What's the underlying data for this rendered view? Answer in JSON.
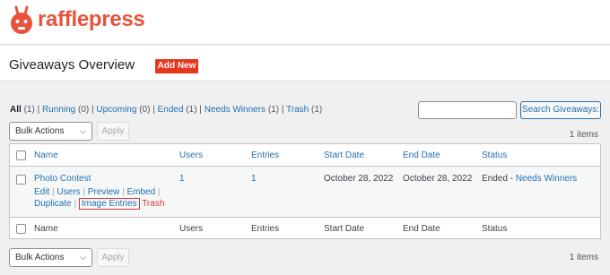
{
  "brand": {
    "name": "rafflepress",
    "color": "#e8543b"
  },
  "header": {
    "title": "Giveaways Overview",
    "add_new_label": "Add New"
  },
  "filters": [
    {
      "label": "All",
      "count": "(1)"
    },
    {
      "label": "Running",
      "count": "(0)"
    },
    {
      "label": "Upcoming",
      "count": "(0)"
    },
    {
      "label": "Ended",
      "count": "(1)"
    },
    {
      "label": "Needs Winners",
      "count": "(1)"
    },
    {
      "label": "Trash",
      "count": "(1)"
    }
  ],
  "search": {
    "button_label": "Search Giveaways:",
    "value": ""
  },
  "bulk": {
    "selected": "Bulk Actions",
    "apply_label": "Apply"
  },
  "items_count": "1 items",
  "columns": [
    "Name",
    "Users",
    "Entries",
    "Start Date",
    "End Date",
    "Status"
  ],
  "row": {
    "name": "Photo Contest",
    "users": "1",
    "entries": "1",
    "start_date": "October 28, 2022",
    "end_date": "October 28, 2022",
    "status_prefix": "Ended - ",
    "status_link": "Needs Winners",
    "actions": [
      "Edit",
      "Users",
      "Preview",
      "Embed",
      "Duplicate",
      "Image Entries",
      "Trash"
    ]
  },
  "separator": "|",
  "icons": {
    "logo": "rabbit-logo-icon",
    "dropdown": "chevron-down-icon"
  }
}
